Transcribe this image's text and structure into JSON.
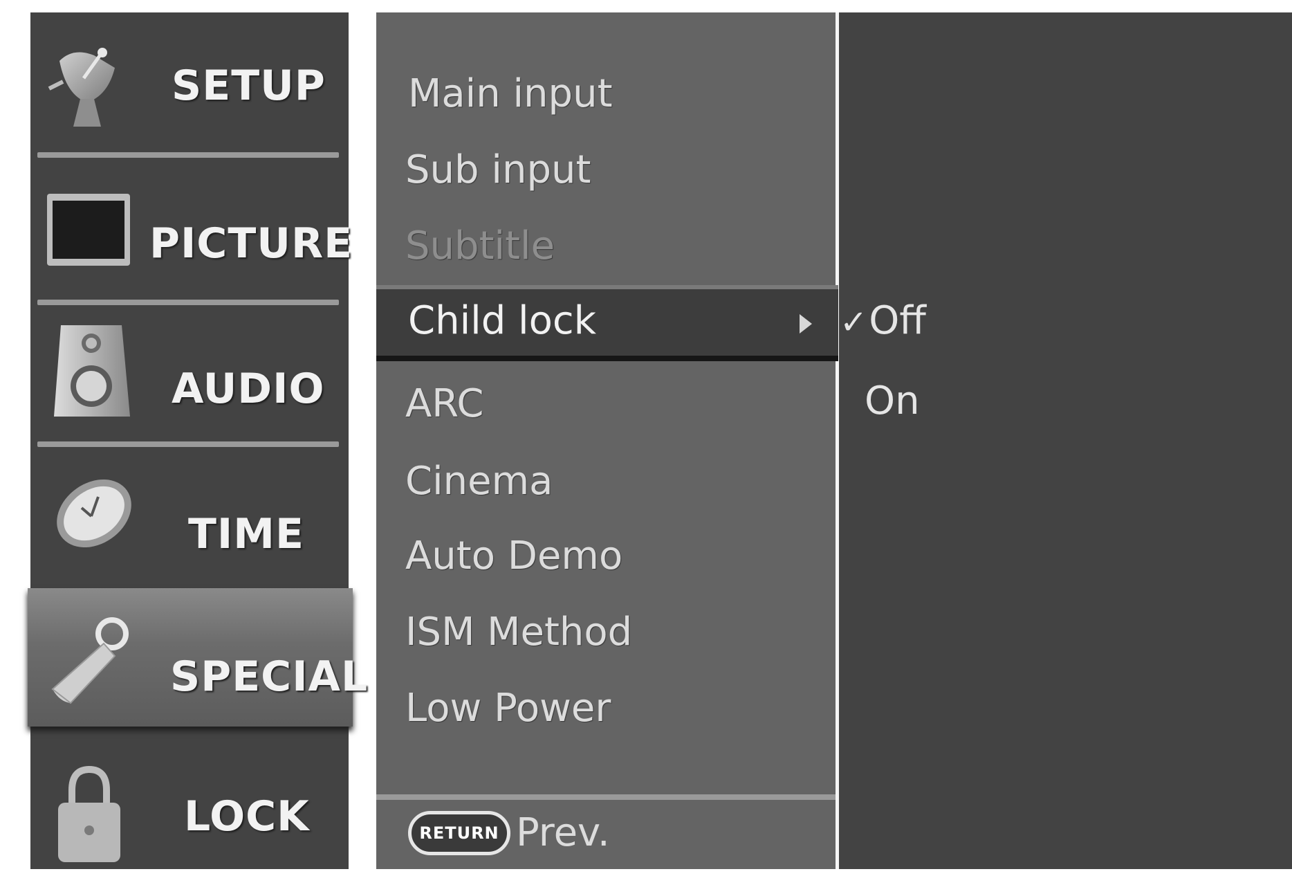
{
  "main_menu": {
    "items": [
      {
        "label": "SETUP",
        "icon": "satellite-dish-icon",
        "selected": false
      },
      {
        "label": "PICTURE",
        "icon": "tv-screen-icon",
        "selected": false
      },
      {
        "label": "AUDIO",
        "icon": "speaker-icon",
        "selected": false
      },
      {
        "label": "TIME",
        "icon": "clock-icon",
        "selected": false
      },
      {
        "label": "SPECIAL",
        "icon": "key-tag-icon",
        "selected": true
      },
      {
        "label": "LOCK",
        "icon": "padlock-icon",
        "selected": false
      }
    ]
  },
  "submenu": {
    "items": [
      {
        "label": "Main input",
        "enabled": true
      },
      {
        "label": "Sub input",
        "enabled": true
      },
      {
        "label": "Subtitle",
        "enabled": false
      },
      {
        "label": "Child lock",
        "enabled": true,
        "highlighted": true
      },
      {
        "label": "ARC",
        "enabled": true
      },
      {
        "label": "Cinema",
        "enabled": true
      },
      {
        "label": "Auto Demo",
        "enabled": true
      },
      {
        "label": "ISM Method",
        "enabled": true
      },
      {
        "label": "Low Power",
        "enabled": true
      }
    ],
    "return_button_label": "RETURN",
    "prev_label": "Prev."
  },
  "options": {
    "items": [
      {
        "label": "Off",
        "checked": true
      },
      {
        "label": "On",
        "checked": false
      }
    ],
    "check_glyph": "✓"
  },
  "colors": {
    "menu_bg": "#434343",
    "submenu_bg": "#646464",
    "highlight_bg": "#3d3d3d",
    "text": "#dcdcdc"
  }
}
